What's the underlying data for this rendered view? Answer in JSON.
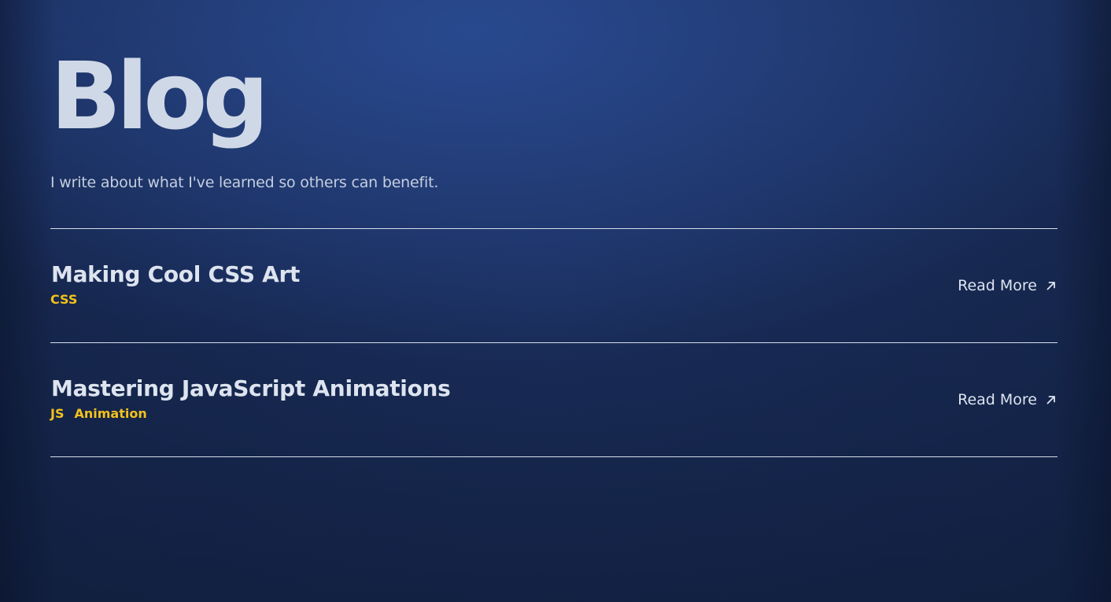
{
  "header": {
    "title": "Blog",
    "subtitle": "I write about what I've learned so others can benefit."
  },
  "posts": [
    {
      "title": "Making Cool CSS Art",
      "tags": [
        "CSS"
      ],
      "read_more_label": "Read More",
      "read_more_icon": "arrow-up-right-icon"
    },
    {
      "title": "Mastering JavaScript Animations",
      "tags": [
        "JS",
        "Animation"
      ],
      "read_more_label": "Read More",
      "read_more_icon": "arrow-up-right-icon"
    }
  ],
  "colors": {
    "background": "#1b2f5e",
    "title": "#cfd8e6",
    "text": "#dde4ef",
    "tag": "#f2c21b",
    "divider": "#d7deea"
  }
}
